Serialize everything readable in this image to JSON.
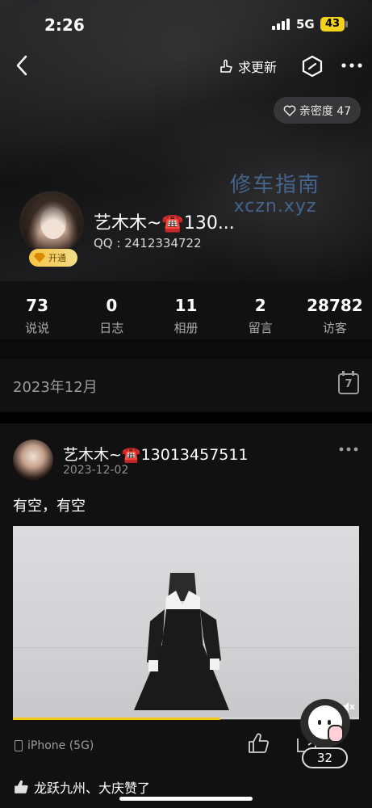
{
  "status_bar": {
    "time": "2:26",
    "network": "5G",
    "battery": "43"
  },
  "nav": {
    "pull_update_label": "求更新"
  },
  "profile": {
    "intimacy_label": "亲密度 47",
    "watermark_line1": "修车指南",
    "watermark_line2": "xczn.xyz",
    "name": "艺木木~☎️130...",
    "qq": "QQ : 2412334722",
    "vip_label": "开通"
  },
  "stats": [
    {
      "value": "73",
      "label": "说说"
    },
    {
      "value": "0",
      "label": "日志"
    },
    {
      "value": "11",
      "label": "相册"
    },
    {
      "value": "2",
      "label": "留言"
    },
    {
      "value": "28782",
      "label": "访客"
    }
  ],
  "timeline": {
    "month": "2023年12月",
    "calendar_day": "7"
  },
  "post": {
    "author": "艺木木~☎️13013457511",
    "date": "2023-12-02",
    "text": "有空，有空",
    "video_progress": 0.6,
    "device": "iPhone (5G)",
    "comment_count": "32",
    "likes_text": "龙跃九州、大庆赞了"
  },
  "colors": {
    "accent": "#f5c518",
    "battery": "#f3d21a"
  }
}
